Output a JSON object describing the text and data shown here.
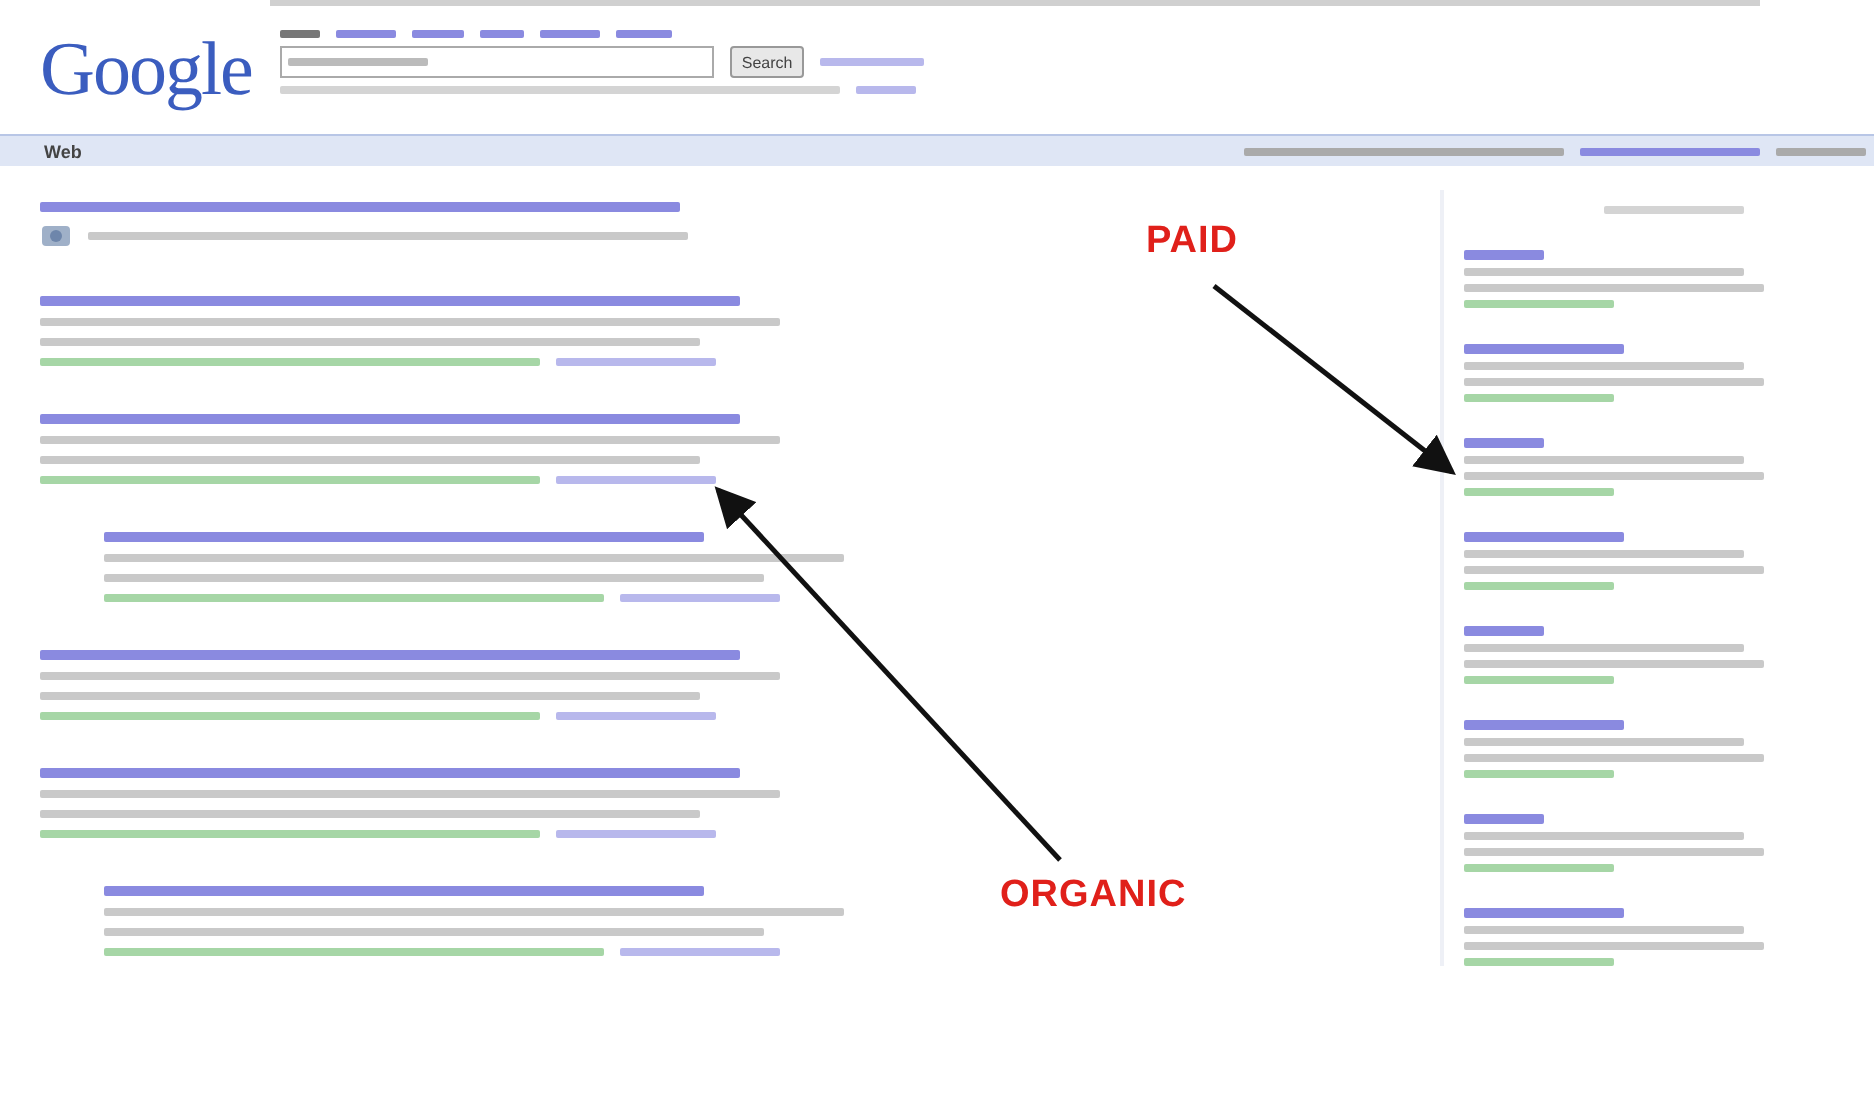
{
  "header": {
    "logo": "Google",
    "search_button": "Search"
  },
  "results_bar": {
    "label": "Web"
  },
  "results": [
    {
      "kind": "local"
    },
    {
      "kind": "result",
      "indented": false
    },
    {
      "kind": "result",
      "indented": false
    },
    {
      "kind": "result",
      "indented": true
    },
    {
      "kind": "result",
      "indented": false
    },
    {
      "kind": "result",
      "indented": false
    },
    {
      "kind": "result",
      "indented": true
    }
  ],
  "ads": [
    {
      "kind": "ad"
    },
    {
      "kind": "ad"
    },
    {
      "kind": "ad"
    },
    {
      "kind": "ad"
    },
    {
      "kind": "ad"
    },
    {
      "kind": "ad"
    },
    {
      "kind": "ad"
    },
    {
      "kind": "ad"
    }
  ],
  "annotations": [
    {
      "label": "PAID",
      "kind": "paid"
    },
    {
      "label": "ORGANIC",
      "kind": "organic"
    }
  ]
}
